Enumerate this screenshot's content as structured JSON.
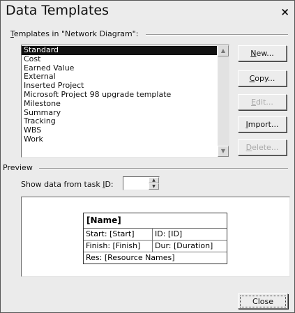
{
  "dialog": {
    "title": "Data Templates",
    "close_glyph": "×"
  },
  "templates": {
    "label_prefix": "",
    "label_mnemonic": "T",
    "label_rest": "emplates in \"Network Diagram\":",
    "items": [
      "Standard",
      "Cost",
      "Earned Value",
      "External",
      "Inserted Project",
      "Microsoft Project 98 upgrade template",
      "Milestone",
      "Summary",
      "Tracking",
      "WBS",
      "Work"
    ],
    "selected_index": 0
  },
  "buttons": {
    "new": {
      "mnemonic": "N",
      "rest": "ew..."
    },
    "copy": {
      "mnemonic": "C",
      "rest": "opy..."
    },
    "edit": {
      "pre": "",
      "mnemonic": "E",
      "rest": "dit..."
    },
    "import": {
      "pre": "",
      "mnemonic": "I",
      "rest": "mport..."
    },
    "delete": {
      "mnemonic": "D",
      "rest": "elete..."
    },
    "close": {
      "label": "Close"
    }
  },
  "preview": {
    "label": "Preview",
    "task_id_prefix": "Show data from task ",
    "task_id_mnemonic": "I",
    "task_id_suffix": "D:",
    "task_id_value": "",
    "node": {
      "name": "[Name]",
      "start": "Start:  [Start]",
      "id": "ID:   [ID]",
      "finish": "Finish: [Finish]",
      "dur": "Dur: [Duration]",
      "res": "Res:    [Resource Names]"
    }
  },
  "icons": {
    "scroll_up": "▲",
    "scroll_down": "▼",
    "spin_up": "▲",
    "spin_down": "▼"
  }
}
